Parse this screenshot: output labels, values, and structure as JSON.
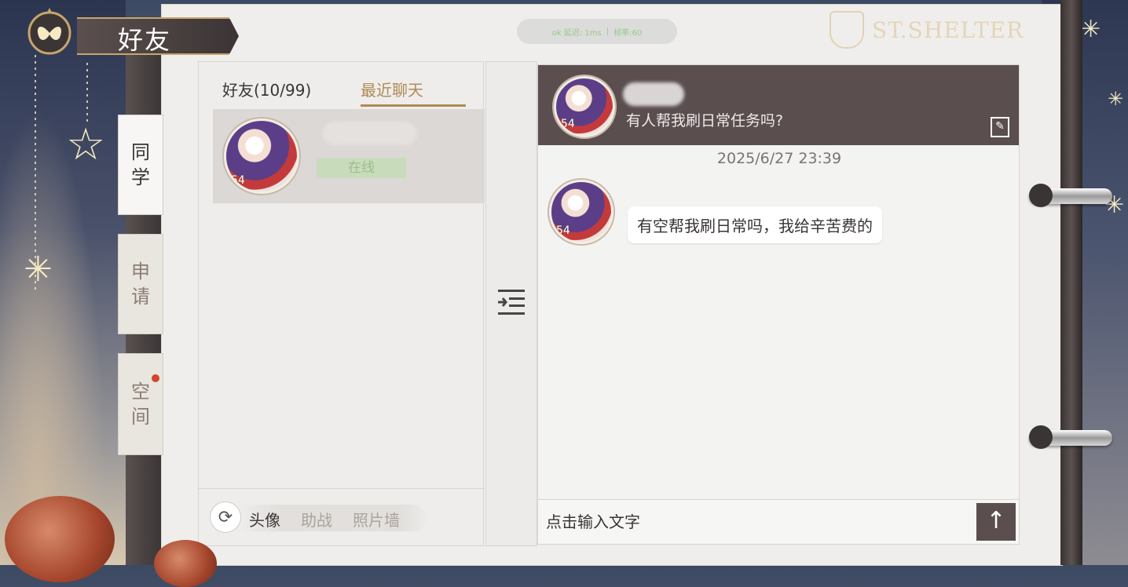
{
  "title": "好友",
  "brand": "ST.SHELTER",
  "top_pill": {
    "left": "ok 延迟: 1ms",
    "right": "帧率:60"
  },
  "side_tabs": [
    {
      "label_top": "同",
      "label_bottom": "学",
      "active": true
    },
    {
      "label_top": "申",
      "label_bottom": "请",
      "active": false
    },
    {
      "label_top": "空",
      "label_bottom": "间",
      "active": false,
      "badge": true
    }
  ],
  "friends": {
    "tab_friends": "好友(10/99)",
    "tab_recent": "最近聊天",
    "list": [
      {
        "level": "54",
        "status": "在线"
      }
    ],
    "footer": {
      "avatar": "头像",
      "assist": "助战",
      "photo_wall": "照片墙"
    }
  },
  "chat": {
    "header_level": "54",
    "header_message": "有人帮我刷日常任务吗?",
    "timestamp": "2025/6/27  23:39",
    "messages": [
      {
        "level": "54",
        "text": "有空帮我刷日常吗，我给辛苦费的"
      }
    ],
    "input_placeholder": "点击输入文字",
    "send_icon": "↑"
  },
  "colors": {
    "accent": "#b08a56",
    "header_bg": "#5a4e4f",
    "online": "#c8dcbc",
    "badge": "#d2452e"
  }
}
